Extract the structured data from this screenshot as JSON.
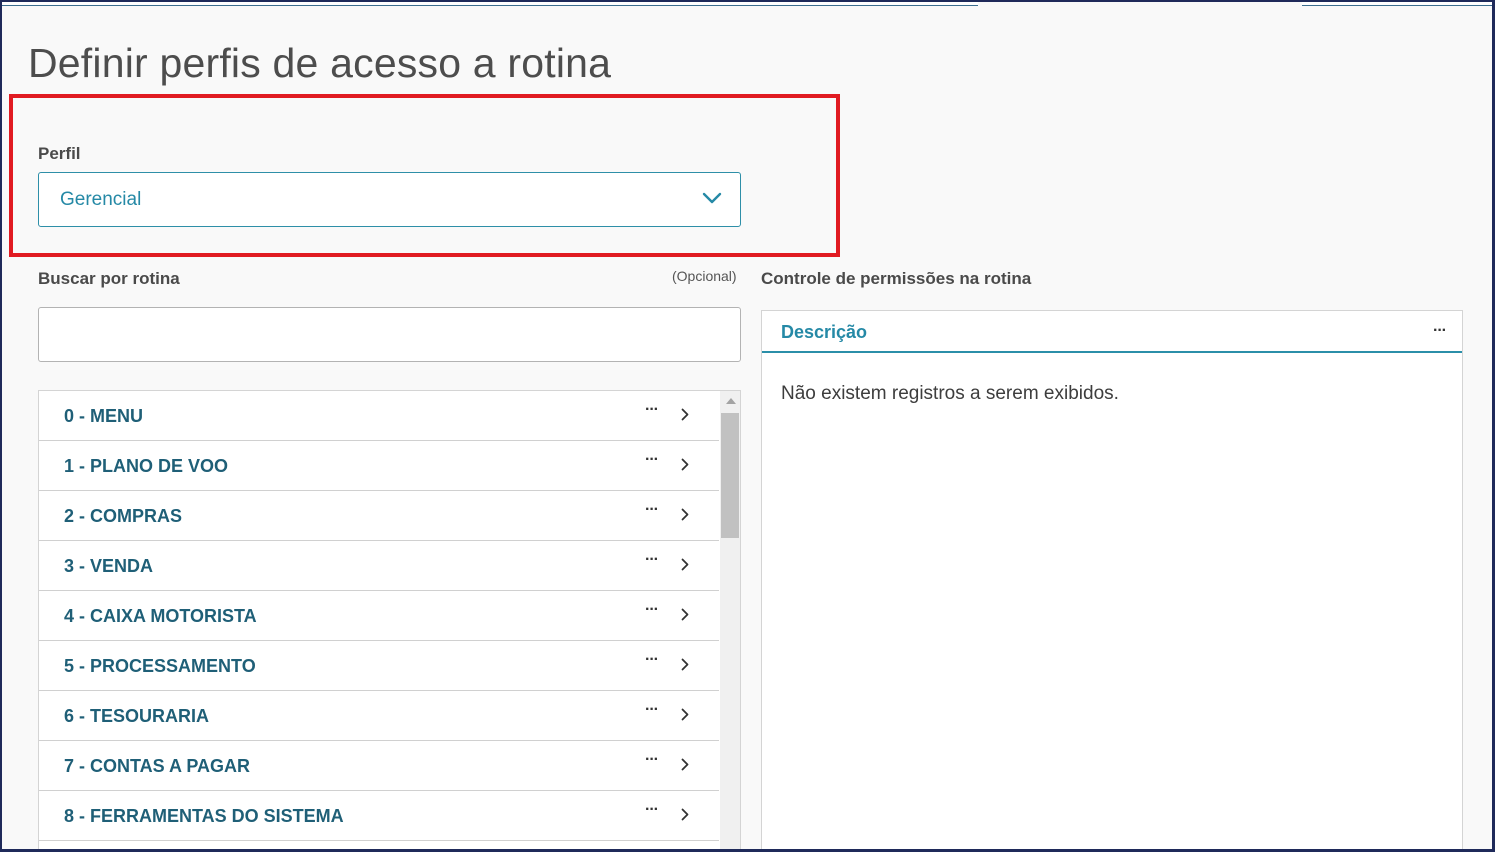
{
  "page": {
    "title": "Definir perfis de acesso a rotina"
  },
  "perfil": {
    "label": "Perfil",
    "selected": "Gerencial"
  },
  "search": {
    "label": "Buscar por rotina",
    "optional": "(Opcional)",
    "value": ""
  },
  "routines": [
    {
      "label": "0 - MENU"
    },
    {
      "label": "1 - PLANO DE VOO"
    },
    {
      "label": "2 - COMPRAS"
    },
    {
      "label": "3 - VENDA"
    },
    {
      "label": "4 - CAIXA MOTORISTA"
    },
    {
      "label": "5 - PROCESSAMENTO"
    },
    {
      "label": "6 - TESOURARIA"
    },
    {
      "label": "7 - CONTAS A PAGAR"
    },
    {
      "label": "8 - FERRAMENTAS DO SISTEMA"
    }
  ],
  "row_actions": {
    "more": "···"
  },
  "permissions": {
    "title": "Controle de permissões na rotina",
    "column": "Descrição",
    "more": "···",
    "empty_message": "Não existem registros a serem exibidos."
  },
  "colors": {
    "accent": "#2589a6",
    "highlight": "#e11b22",
    "routine_text": "#1f5f77"
  },
  "icons": {
    "select": "chevron-down-icon",
    "row_open": "chevron-right-icon",
    "row_more": "more-horizontal-icon"
  }
}
